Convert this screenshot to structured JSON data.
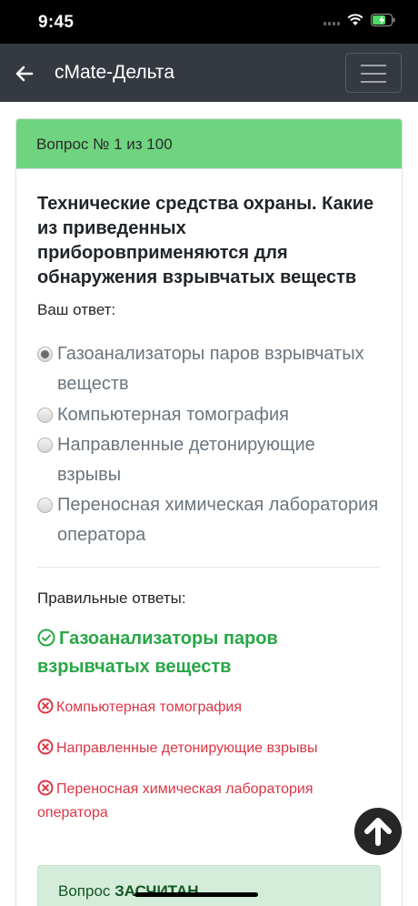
{
  "status_bar": {
    "time": "9:45",
    "battery_color": "#4cd964"
  },
  "navbar": {
    "title": "cMate-Дельта",
    "back_icon": "arrow-left-icon",
    "menu_icon": "hamburger-icon"
  },
  "question": {
    "header": "Вопрос № 1 из 100",
    "text": "Технические средства охраны. Какие из приведенных приборовприменяются для обнаружения взрывчатых веществ",
    "your_answer_label": "Ваш ответ:",
    "options": [
      {
        "label": "Газоанализаторы паров взрывчатых веществ",
        "selected": true
      },
      {
        "label": "Компьютерная томография",
        "selected": false
      },
      {
        "label": "Направленные детонирующие взрывы",
        "selected": false
      },
      {
        "label": "Переносная химическая лаборатория оператора",
        "selected": false
      }
    ]
  },
  "answers": {
    "label": "Правильные ответы:",
    "correct": "Газоанализаторы паров взрывчатых веществ",
    "wrong": [
      "Компьютерная томография",
      "Направленные детонирующие взрывы",
      "Переносная химическая лаборатория оператора"
    ]
  },
  "result": {
    "prefix": "Вопрос",
    "status": "ЗАСЧИТАН"
  },
  "colors": {
    "header_green": "#6fd47f",
    "correct_green": "#28a745",
    "wrong_red": "#dc3545",
    "navbar": "#343a40"
  }
}
